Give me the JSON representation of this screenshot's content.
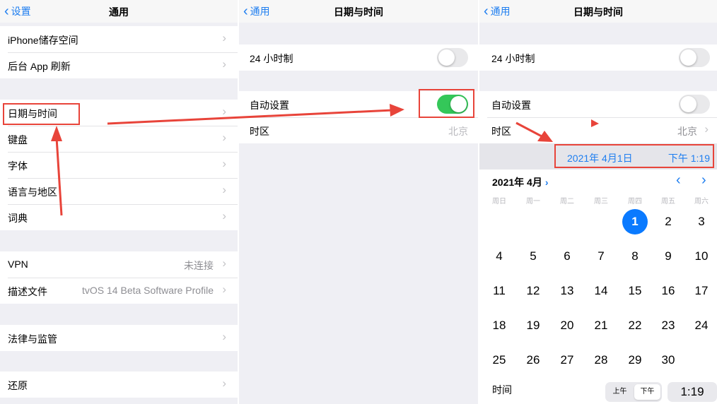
{
  "panel1": {
    "back_label": "设置",
    "title": "通用",
    "group1": [
      {
        "label": "iPhone储存空间"
      },
      {
        "label": "后台 App 刷新"
      }
    ],
    "group2": [
      {
        "label": "日期与时间"
      },
      {
        "label": "键盘"
      },
      {
        "label": "字体"
      },
      {
        "label": "语言与地区"
      },
      {
        "label": "词典"
      }
    ],
    "group3": [
      {
        "label": "VPN",
        "value": "未连接"
      },
      {
        "label": "描述文件",
        "value": "tvOS 14 Beta Software Profile"
      }
    ],
    "group4": [
      {
        "label": "法律与监管"
      }
    ],
    "group5": [
      {
        "label": "还原"
      }
    ]
  },
  "panel2": {
    "back_label": "通用",
    "title": "日期与时间",
    "hour24_label": "24 小时制",
    "hour24_on": false,
    "auto_label": "自动设置",
    "auto_on": true,
    "timezone_label": "时区",
    "timezone_value": "北京"
  },
  "panel3": {
    "back_label": "通用",
    "title": "日期与时间",
    "hour24_label": "24 小时制",
    "hour24_on": false,
    "auto_label": "自动设置",
    "auto_on": false,
    "timezone_label": "时区",
    "timezone_value": "北京",
    "selected_date": "2021年 4月1日",
    "selected_time": "下午 1:19",
    "calendar": {
      "month_label": "2021年 4月",
      "weekdays": [
        "周日",
        "周一",
        "周二",
        "周三",
        "周四",
        "周五",
        "周六"
      ],
      "first_weekday": 4,
      "days_in_month": 30,
      "selected_day": 1
    },
    "time_label": "时间",
    "am_label": "上午",
    "pm_label": "下午",
    "time_value": "1:19"
  },
  "colors": {
    "accent": "#1e7ef0",
    "toggle_on": "#34c759",
    "annotation_red": "#e8443a",
    "selected_day": "#0a7aff"
  },
  "icons": [
    "chevron-left-icon",
    "chevron-right-icon",
    "toggle-switch",
    "annotation-arrow"
  ]
}
